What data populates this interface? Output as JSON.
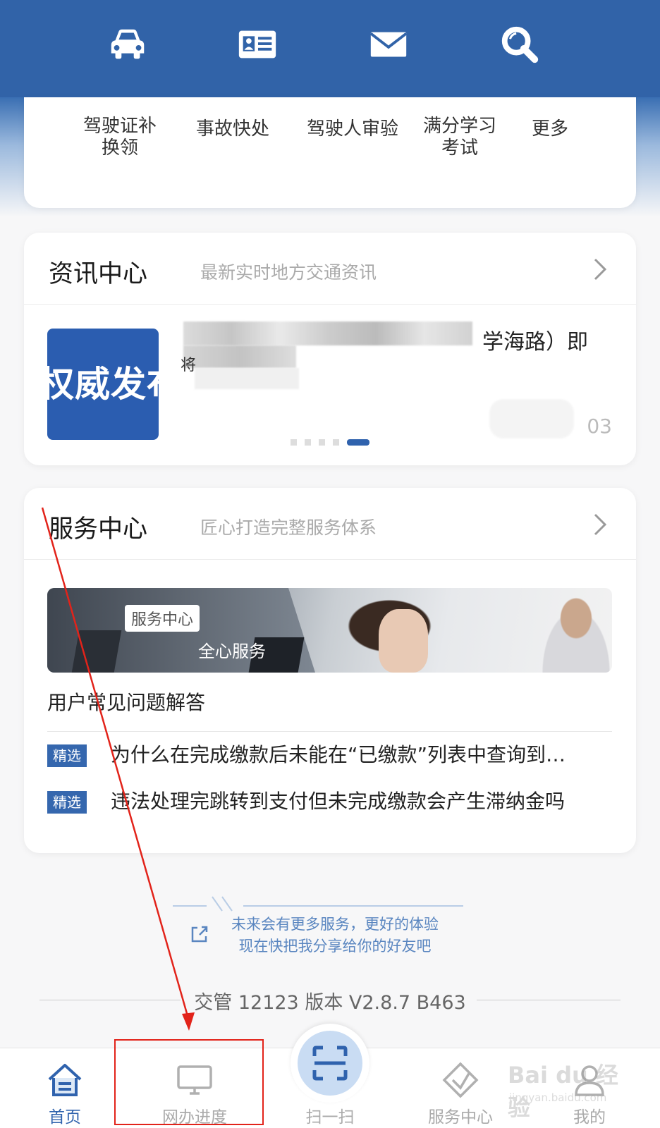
{
  "top_icons": [
    "car-icon",
    "id-card-icon",
    "mail-icon",
    "search-icon"
  ],
  "quick_services": [
    {
      "label_line1": "驾驶证补",
      "label_line2": "换领"
    },
    {
      "label_line1": "事故快处",
      "label_line2": ""
    },
    {
      "label_line1": "驾驶人审验",
      "label_line2": ""
    },
    {
      "label_line1": "满分学习",
      "label_line2": "考试"
    },
    {
      "label_line1": "更多",
      "label_line2": ""
    }
  ],
  "news": {
    "title": "资讯中心",
    "subtitle": "最新实时地方交通资讯",
    "thumb_text": "权威发布",
    "headline_visible": "学海路）即",
    "headline_fragment": "将",
    "date_visible": "03"
  },
  "service": {
    "title": "服务中心",
    "subtitle": "匠心打造完整服务体系",
    "banner_tag": "服务中心",
    "banner_text": "全心服务",
    "faq_title": "用户常见问题解答",
    "faq_items": [
      {
        "badge": "精选",
        "text": "为什么在完成缴款后未能在“已缴款”列表中查询到…"
      },
      {
        "badge": "精选",
        "text": "违法处理完跳转到支付但未完成缴款会产生滞纳金吗"
      }
    ]
  },
  "share": {
    "line1": "未来会有更多服务，更好的体验",
    "line2": "现在快把我分享给你的好友吧"
  },
  "version": "交管 12123 版本 V2.8.7 B463",
  "tabs": [
    {
      "label": "首页",
      "icon": "home-icon",
      "active": true
    },
    {
      "label": "网办进度",
      "icon": "monitor-icon",
      "active": false
    },
    {
      "label": "扫一扫",
      "icon": "scan-icon",
      "active": false
    },
    {
      "label": "服务中心",
      "icon": "diamond-icon",
      "active": false
    },
    {
      "label": "我的",
      "icon": "user-icon",
      "active": false
    }
  ],
  "watermark": {
    "line1": "Bai du 经验",
    "line2": "jingyan.baidu.com"
  },
  "colors": {
    "primary": "#3163a8",
    "annotation": "#e2231a",
    "tab_active": "#2f62ad"
  }
}
